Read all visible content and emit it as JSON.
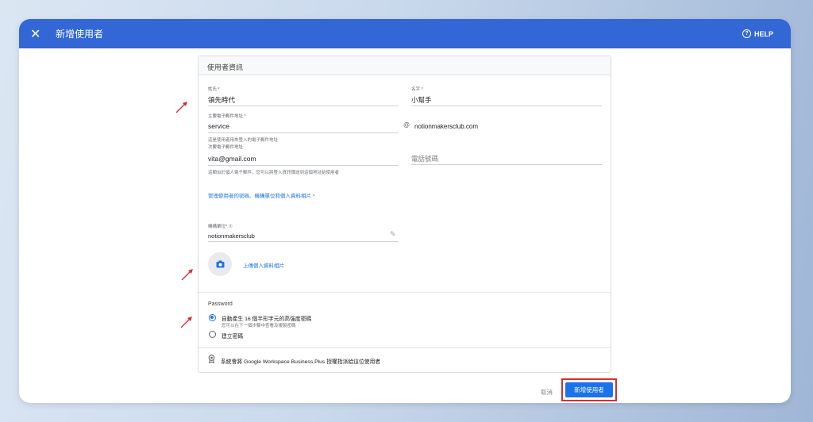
{
  "header": {
    "close_icon": "close-icon",
    "title": "新增使用者",
    "help_label": "HELP"
  },
  "card": {
    "title": "使用者資訊",
    "last_name": {
      "label": "姓氏 *",
      "value": "領先時代"
    },
    "first_name": {
      "label": "名字 *",
      "value": "小幫手"
    },
    "primary_email": {
      "label": "主要電子郵件地址 *",
      "value": "service",
      "domain": "notionmakersclub.com",
      "hint": "這是使用者用來登入的電子郵件地址"
    },
    "secondary_email": {
      "label": "次要電子郵件地址",
      "value": "vita@gmail.com",
      "hint": "這類似於個人電子郵件，您可以將登入資訊傳送到這個地址給使用者"
    },
    "phone": {
      "placeholder": "電話號碼"
    },
    "manage_link": "管理使用者的密碼、機構單位和個人資料相片 ^",
    "org_unit": {
      "label": "機構單位* ⑦",
      "value": "notionmakersclub"
    },
    "upload_photo": "上傳個人資料相片",
    "password": {
      "title": "Password",
      "auto_option": "自動產生 16 個半形字元的高強度密碼",
      "auto_hint": "您可以在下一個步驟中查看及複製密碼",
      "auto_selected": true,
      "create_option": "建立密碼"
    },
    "license_notice": "系統會將 Google Workspace Business Plus 授權指派給這位使用者"
  },
  "footer": {
    "cancel_label": "取消",
    "create_label": "新增使用者"
  },
  "colors": {
    "topbar": "#3367d6",
    "primary": "#1a73e8",
    "highlight": "#d32f2f"
  }
}
